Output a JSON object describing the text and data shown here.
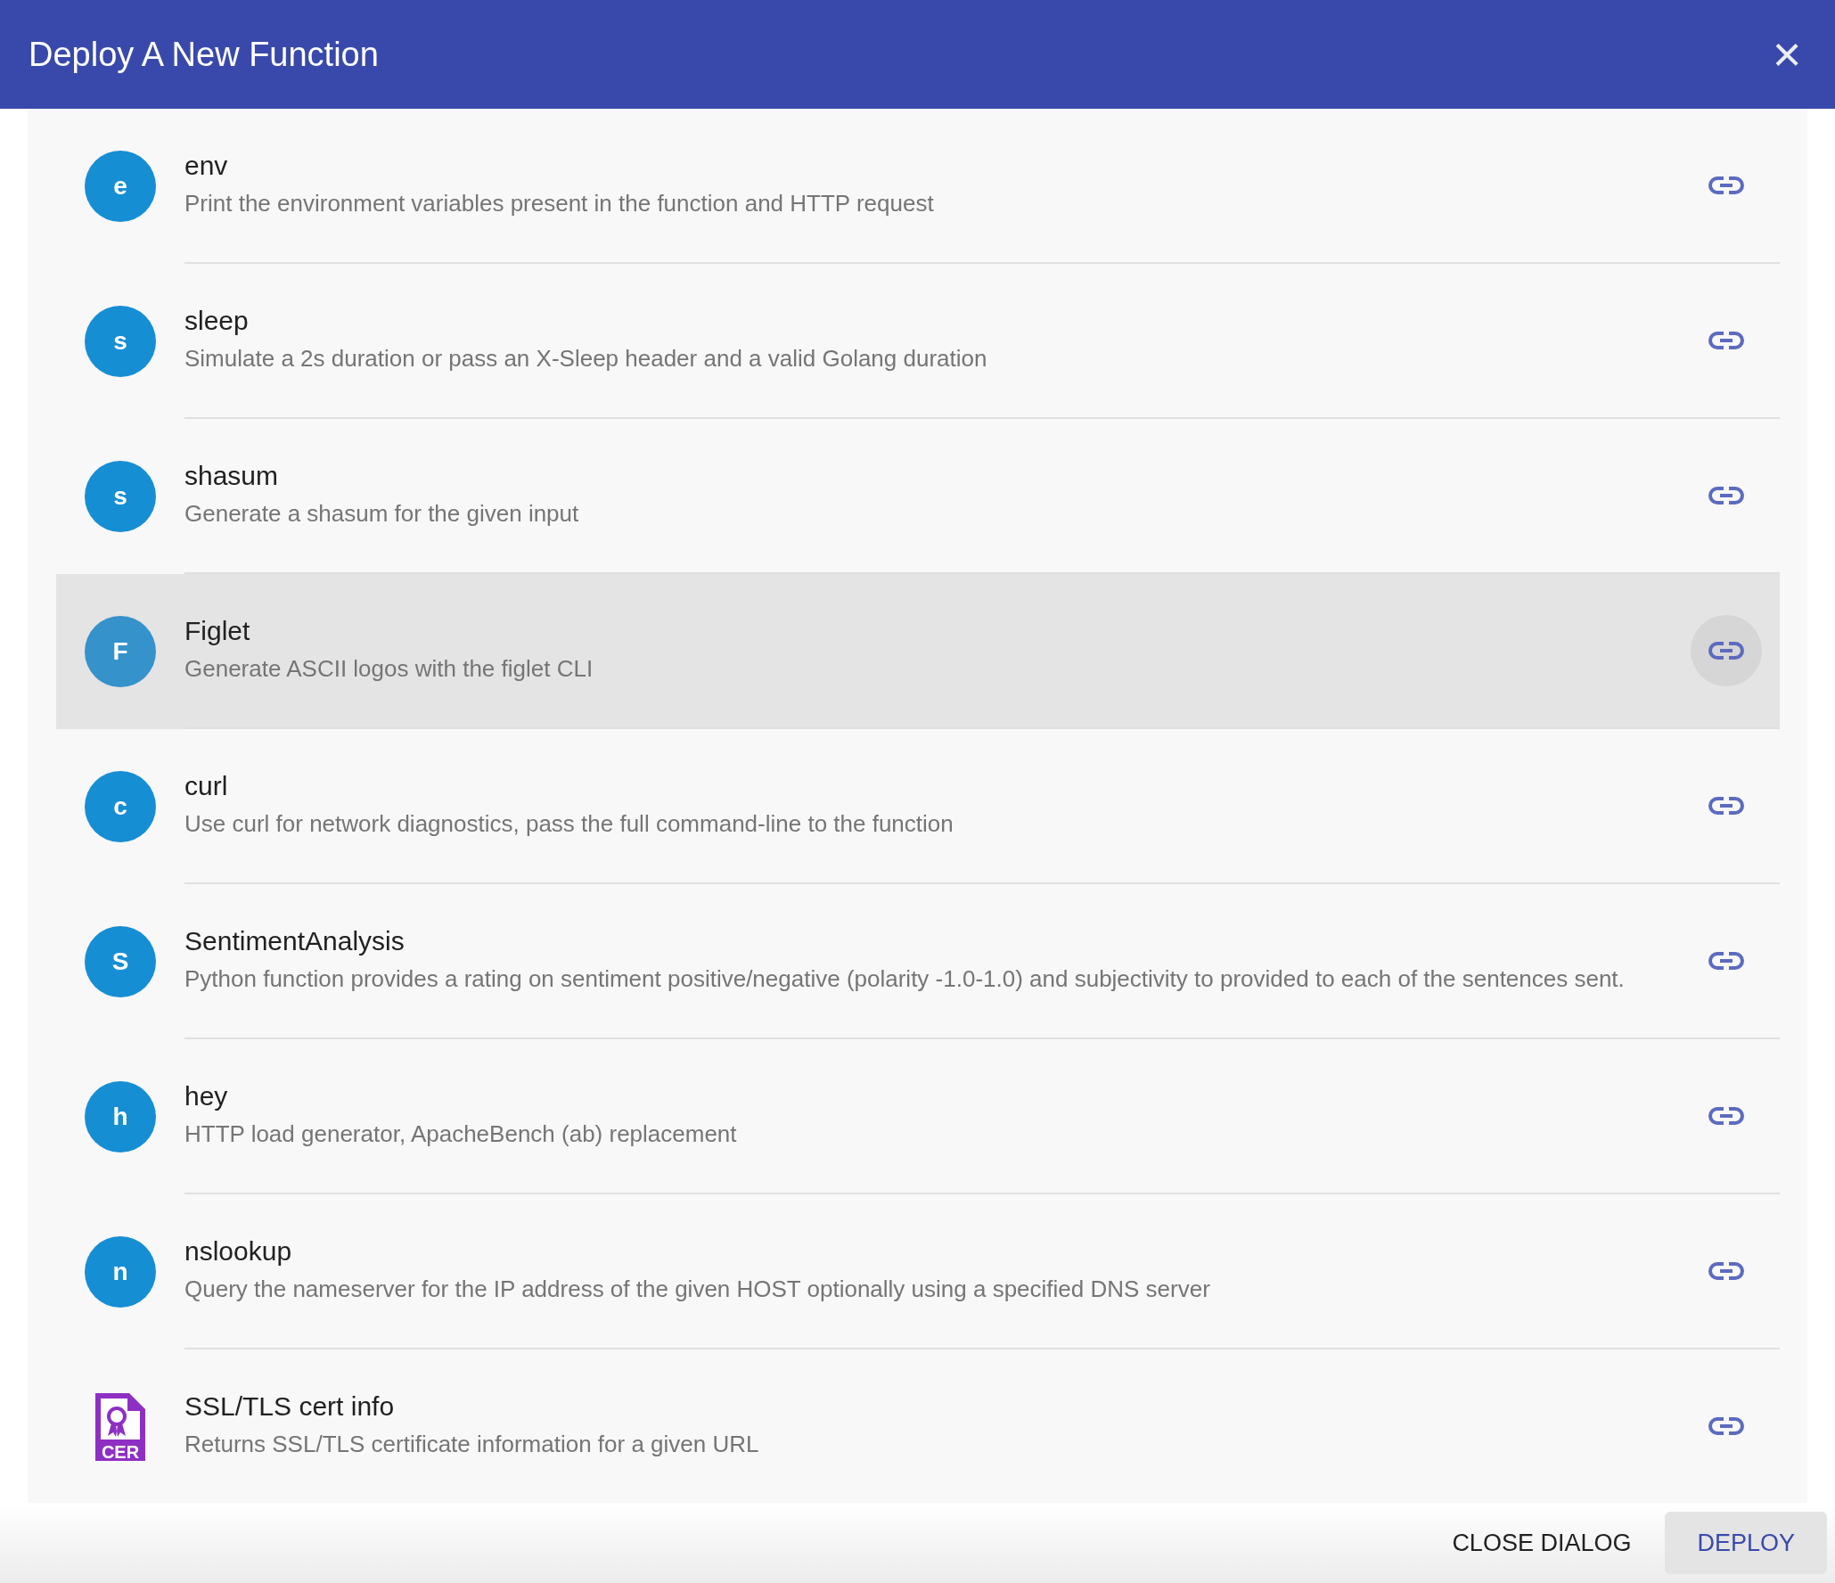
{
  "dialog": {
    "title": "Deploy A New Function",
    "close_icon": "×"
  },
  "functions": [
    {
      "kind": "letter",
      "avatar": "e",
      "name": "env",
      "description": "Print the environment variables present in the function and HTTP request",
      "selected": false
    },
    {
      "kind": "letter",
      "avatar": "s",
      "name": "sleep",
      "description": "Simulate a 2s duration or pass an X-Sleep header and a valid Golang duration",
      "selected": false
    },
    {
      "kind": "letter",
      "avatar": "s",
      "name": "shasum",
      "description": "Generate a shasum for the given input",
      "selected": false
    },
    {
      "kind": "letter",
      "avatar": "F",
      "name": "Figlet",
      "description": "Generate ASCII logos with the figlet CLI",
      "selected": true
    },
    {
      "kind": "letter",
      "avatar": "c",
      "name": "curl",
      "description": "Use curl for network diagnostics, pass the full command-line to the function",
      "selected": false
    },
    {
      "kind": "letter",
      "avatar": "S",
      "name": "SentimentAnalysis",
      "description": "Python function provides a rating on sentiment positive/negative (polarity -1.0-1.0) and subjectivity to provided to each of the sentences sent.",
      "selected": false
    },
    {
      "kind": "letter",
      "avatar": "h",
      "name": "hey",
      "description": "HTTP load generator, ApacheBench (ab) replacement",
      "selected": false
    },
    {
      "kind": "letter",
      "avatar": "n",
      "name": "nslookup",
      "description": "Query the nameserver for the IP address of the given HOST optionally using a specified DNS server",
      "selected": false
    },
    {
      "kind": "certificate",
      "avatar": "CER",
      "name": "SSL/TLS cert info",
      "description": "Returns SSL/TLS certificate information for a given URL",
      "selected": false
    }
  ],
  "buttons": [
    {
      "label": "CLOSE DIALOG",
      "kind": "flat"
    },
    {
      "label": "DEPLOY",
      "kind": "primary"
    }
  ]
}
